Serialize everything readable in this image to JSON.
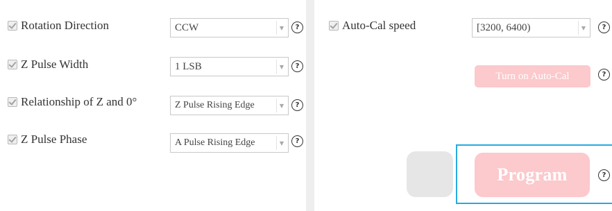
{
  "left_settings": [
    {
      "label": "Rotation Direction",
      "value": "CCW",
      "help": "?"
    },
    {
      "label": "Z Pulse Width",
      "value": "1 LSB",
      "help": "?"
    },
    {
      "label": "Relationship of Z and 0°",
      "value": "Z Pulse Rising Edge",
      "help": "?"
    },
    {
      "label": "Z Pulse Phase",
      "value": "A Pulse Rising Edge",
      "help": "?"
    }
  ],
  "autocal": {
    "speed_label": "Auto-Cal speed",
    "speed_value": "[3200, 6400)",
    "speed_help": "?",
    "button_label": "Turn on Auto-Cal",
    "button_help": "?"
  },
  "program": {
    "button_label": "Program",
    "help": "?"
  },
  "colors": {
    "disabled_button_bg": "#fcc9cc",
    "highlight_frame": "#27a9e1",
    "divider": "#eeeeee"
  },
  "icons": {
    "dropdown": "caret-down-icon",
    "help": "question-circle-icon",
    "checkbox": "checkbox-checked-icon"
  }
}
